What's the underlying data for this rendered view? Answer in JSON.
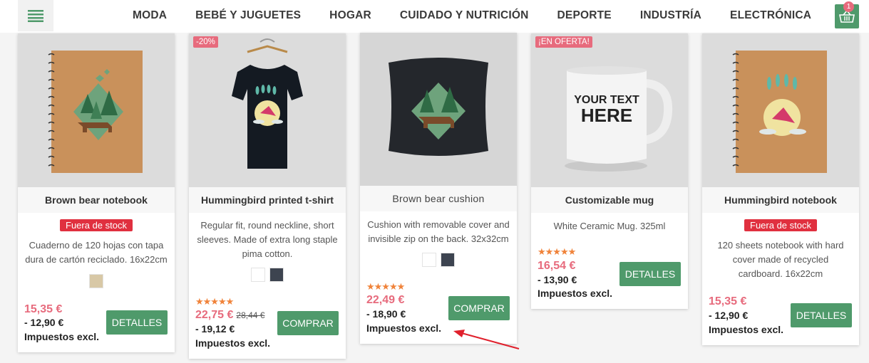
{
  "nav": {
    "items": [
      "MODA",
      "BEBÉ Y JUGUETES",
      "HOGAR",
      "CUIDADO Y NUTRICIÓN",
      "DEPORTE",
      "INDUSTRÍA",
      "ELECTRÓNICA"
    ],
    "cart_count": "1"
  },
  "products": [
    {
      "title": "Brown bear notebook",
      "stock_label": "Fuera de stock",
      "description": "Cuaderno de 120 hojas con tapa dura de cartón reciclado. 16x22cm",
      "swatch_colors": [
        "#d8c8a6"
      ],
      "price": "15,35 €",
      "price_excl": "- 12,90 €",
      "tax_label": "Impuestos excl.",
      "button": "DETALLES"
    },
    {
      "title": "Hummingbird printed t-shirt",
      "badge": "-20%",
      "description": "Regular fit, round neckline, short sleeves. Made of extra long staple pima cotton.",
      "swatch_colors": [
        "#ffffff",
        "#3d4450"
      ],
      "stars": "★★★★★",
      "price": "22,75 €",
      "old_price": "28,44 €",
      "price_excl": "- 19,12 €",
      "tax_label": "Impuestos excl.",
      "button": "COMPRAR"
    },
    {
      "title": "Brown bear cushion",
      "description": "Cushion with removable cover and invisible zip on the back. 32x32cm",
      "swatch_colors": [
        "#ffffff",
        "#3d4450"
      ],
      "stars": "★★★★★",
      "price": "22,49 €",
      "price_excl": "- 18,90 €",
      "tax_label": "Impuestos excl.",
      "button": "COMPRAR"
    },
    {
      "title": "Customizable mug",
      "badge": "¡EN OFERTA!",
      "description": "White Ceramic Mug. 325ml",
      "mug_text": "YOUR TEXT HERE",
      "stars": "★★★★★",
      "price": "16,54 €",
      "price_excl": "- 13,90 €",
      "tax_label": "Impuestos excl.",
      "button": "DETALLES"
    },
    {
      "title": "Hummingbird notebook",
      "stock_label": "Fuera de stock",
      "description": "120 sheets notebook with hard cover made of recycled cardboard. 16x22cm",
      "price": "15,35 €",
      "price_excl": "- 12,90 €",
      "tax_label": "Impuestos excl.",
      "button": "DETALLES"
    }
  ],
  "colors": {
    "accent": "#4f9a6b",
    "price": "#e76b7d",
    "out_of_stock": "#e0303f",
    "stars": "#f0833a",
    "annotation": "#e0202c"
  }
}
